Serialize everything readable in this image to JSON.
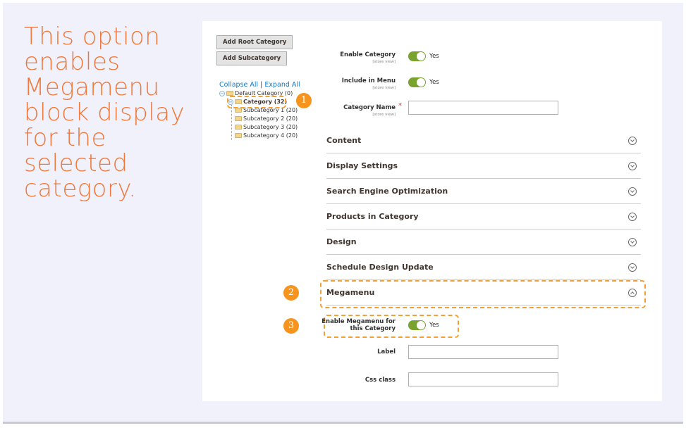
{
  "caption": [
    "This option",
    "enables",
    "Megamenu",
    "block display",
    "for the",
    "selected",
    "category."
  ],
  "buttons": {
    "add_root": "Add Root Category",
    "add_sub": "Add Subcategory"
  },
  "tree": {
    "collapse_all": "Collapse All",
    "separator": "|",
    "expand_all": "Expand All",
    "root": "Default Category (0)",
    "category": "Category (32)",
    "children": [
      "Subcategory 1 (20)",
      "Subcategory 2 (20)",
      "Subcategory 3 (20)",
      "Subcategory 4 (20)"
    ]
  },
  "fields": {
    "enable_category": {
      "label": "Enable Category",
      "scope": "[store view]",
      "value": "Yes"
    },
    "include_in_menu": {
      "label": "Include in Menu",
      "scope": "[store view]",
      "value": "Yes"
    },
    "category_name": {
      "label": "Category Name",
      "scope": "[store view]",
      "required": "*",
      "value": ""
    }
  },
  "sections": [
    "Content",
    "Display Settings",
    "Search Engine Optimization",
    "Products in Category",
    "Design",
    "Schedule Design Update",
    "Megamenu"
  ],
  "megamenu": {
    "enable_label_line1": "Enable Megamenu for",
    "enable_label_line2": "this Category",
    "enable_value": "Yes",
    "label_field": "Label",
    "label_value": "",
    "css_field": "Css class",
    "css_value": ""
  },
  "badges": [
    "1",
    "2",
    "3"
  ],
  "colors": {
    "accent": "#f0783a",
    "badge": "#f7941d",
    "dash": "#f0a035",
    "toggle_on": "#79a22e",
    "link": "#1979c3"
  }
}
